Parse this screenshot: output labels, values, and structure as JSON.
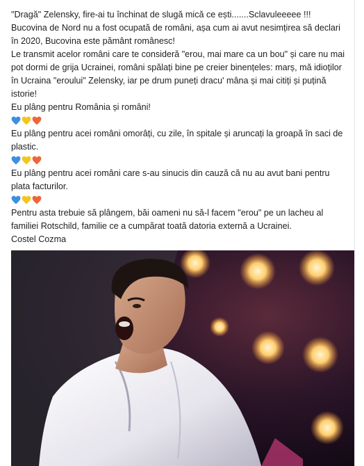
{
  "post": {
    "lines": [
      "\"Dragă\" Zelensky, fire-ai tu închinat de slugă mică ce ești.......Sclavuleeeee !!!",
      "Bucovina de Nord nu a fost ocupată de români, așa cum ai avut nesimțirea să declari",
      "în 2020, Bucovina este pământ românesc!",
      "Le transmit acelor români care te consideră \"erou, mai mare ca un bou\" și care nu mai",
      "pot dormi de grija Ucrainei, români spălați bine pe creier binențeles: marș, mă idioților",
      "în Ucraina \"eroului\" Zelensky, iar pe drum puneți dracu' mâna și mai citiți și puțină",
      "istorie!",
      "Eu plâng pentru România și români!",
      "Eu plâng pentru acei români omorâți, cu zile, în spitale și aruncați la groapă în saci de",
      "plastic.",
      "Eu plâng pentru acei români care s-au sinucis din cauză că nu au avut bani pentru",
      "plata facturilor.",
      "Pentru asta trebuie să plângem, băi oameni nu să-l facem \"erou\" pe un lacheu al",
      "familiei Rotschild, familie ce a cumpărat toată datoria externă a Ucrainei.",
      "Costel Cozma"
    ],
    "heart_colors": {
      "blue": "#3d8fe0",
      "yellow": "#f7c41d",
      "red": "#f0643a"
    }
  }
}
